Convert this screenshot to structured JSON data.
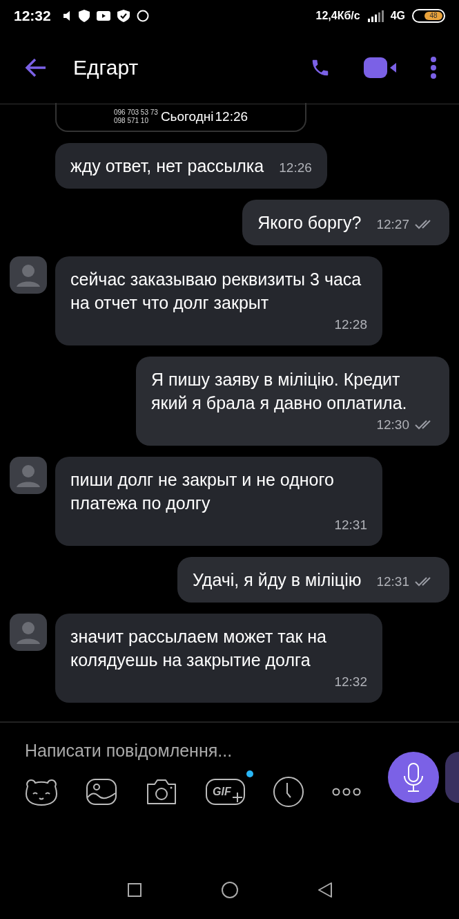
{
  "status_bar": {
    "time": "12:32",
    "speed": "12,4Кб/с",
    "network": "4G",
    "battery": "48"
  },
  "header": {
    "title": "Едгарт"
  },
  "partial_message": {
    "lines": [
      "096 703 53 73",
      "098 571 10"
    ],
    "date": "Сьогодні",
    "time": "12:26"
  },
  "messages": [
    {
      "kind": "in",
      "avatar": false,
      "text": "жду ответ, нет рассылка",
      "time": "12:26"
    },
    {
      "kind": "out",
      "text": "Якого боргу?",
      "time": "12:27"
    },
    {
      "kind": "in",
      "avatar": true,
      "text": "сейчас заказываю реквизиты 3 часа на отчет что долг закрыт",
      "time": "12:28"
    },
    {
      "kind": "out",
      "text": "Я пишу заяву в міліцію. Кредит який я брала я давно оплатила.",
      "time": "12:30"
    },
    {
      "kind": "in",
      "avatar": true,
      "text": "пиши долг не закрыт и не одного платежа по долгу",
      "time": "12:31"
    },
    {
      "kind": "out",
      "text": "Удачі, я йду в міліцію",
      "time": "12:31"
    },
    {
      "kind": "in",
      "avatar": true,
      "text": "значит рассылаем может так на колядуешь на закрытие долга",
      "time": "12:32"
    }
  ],
  "composer": {
    "placeholder": "Написати повідомлення...",
    "gif_label": "GIF"
  }
}
